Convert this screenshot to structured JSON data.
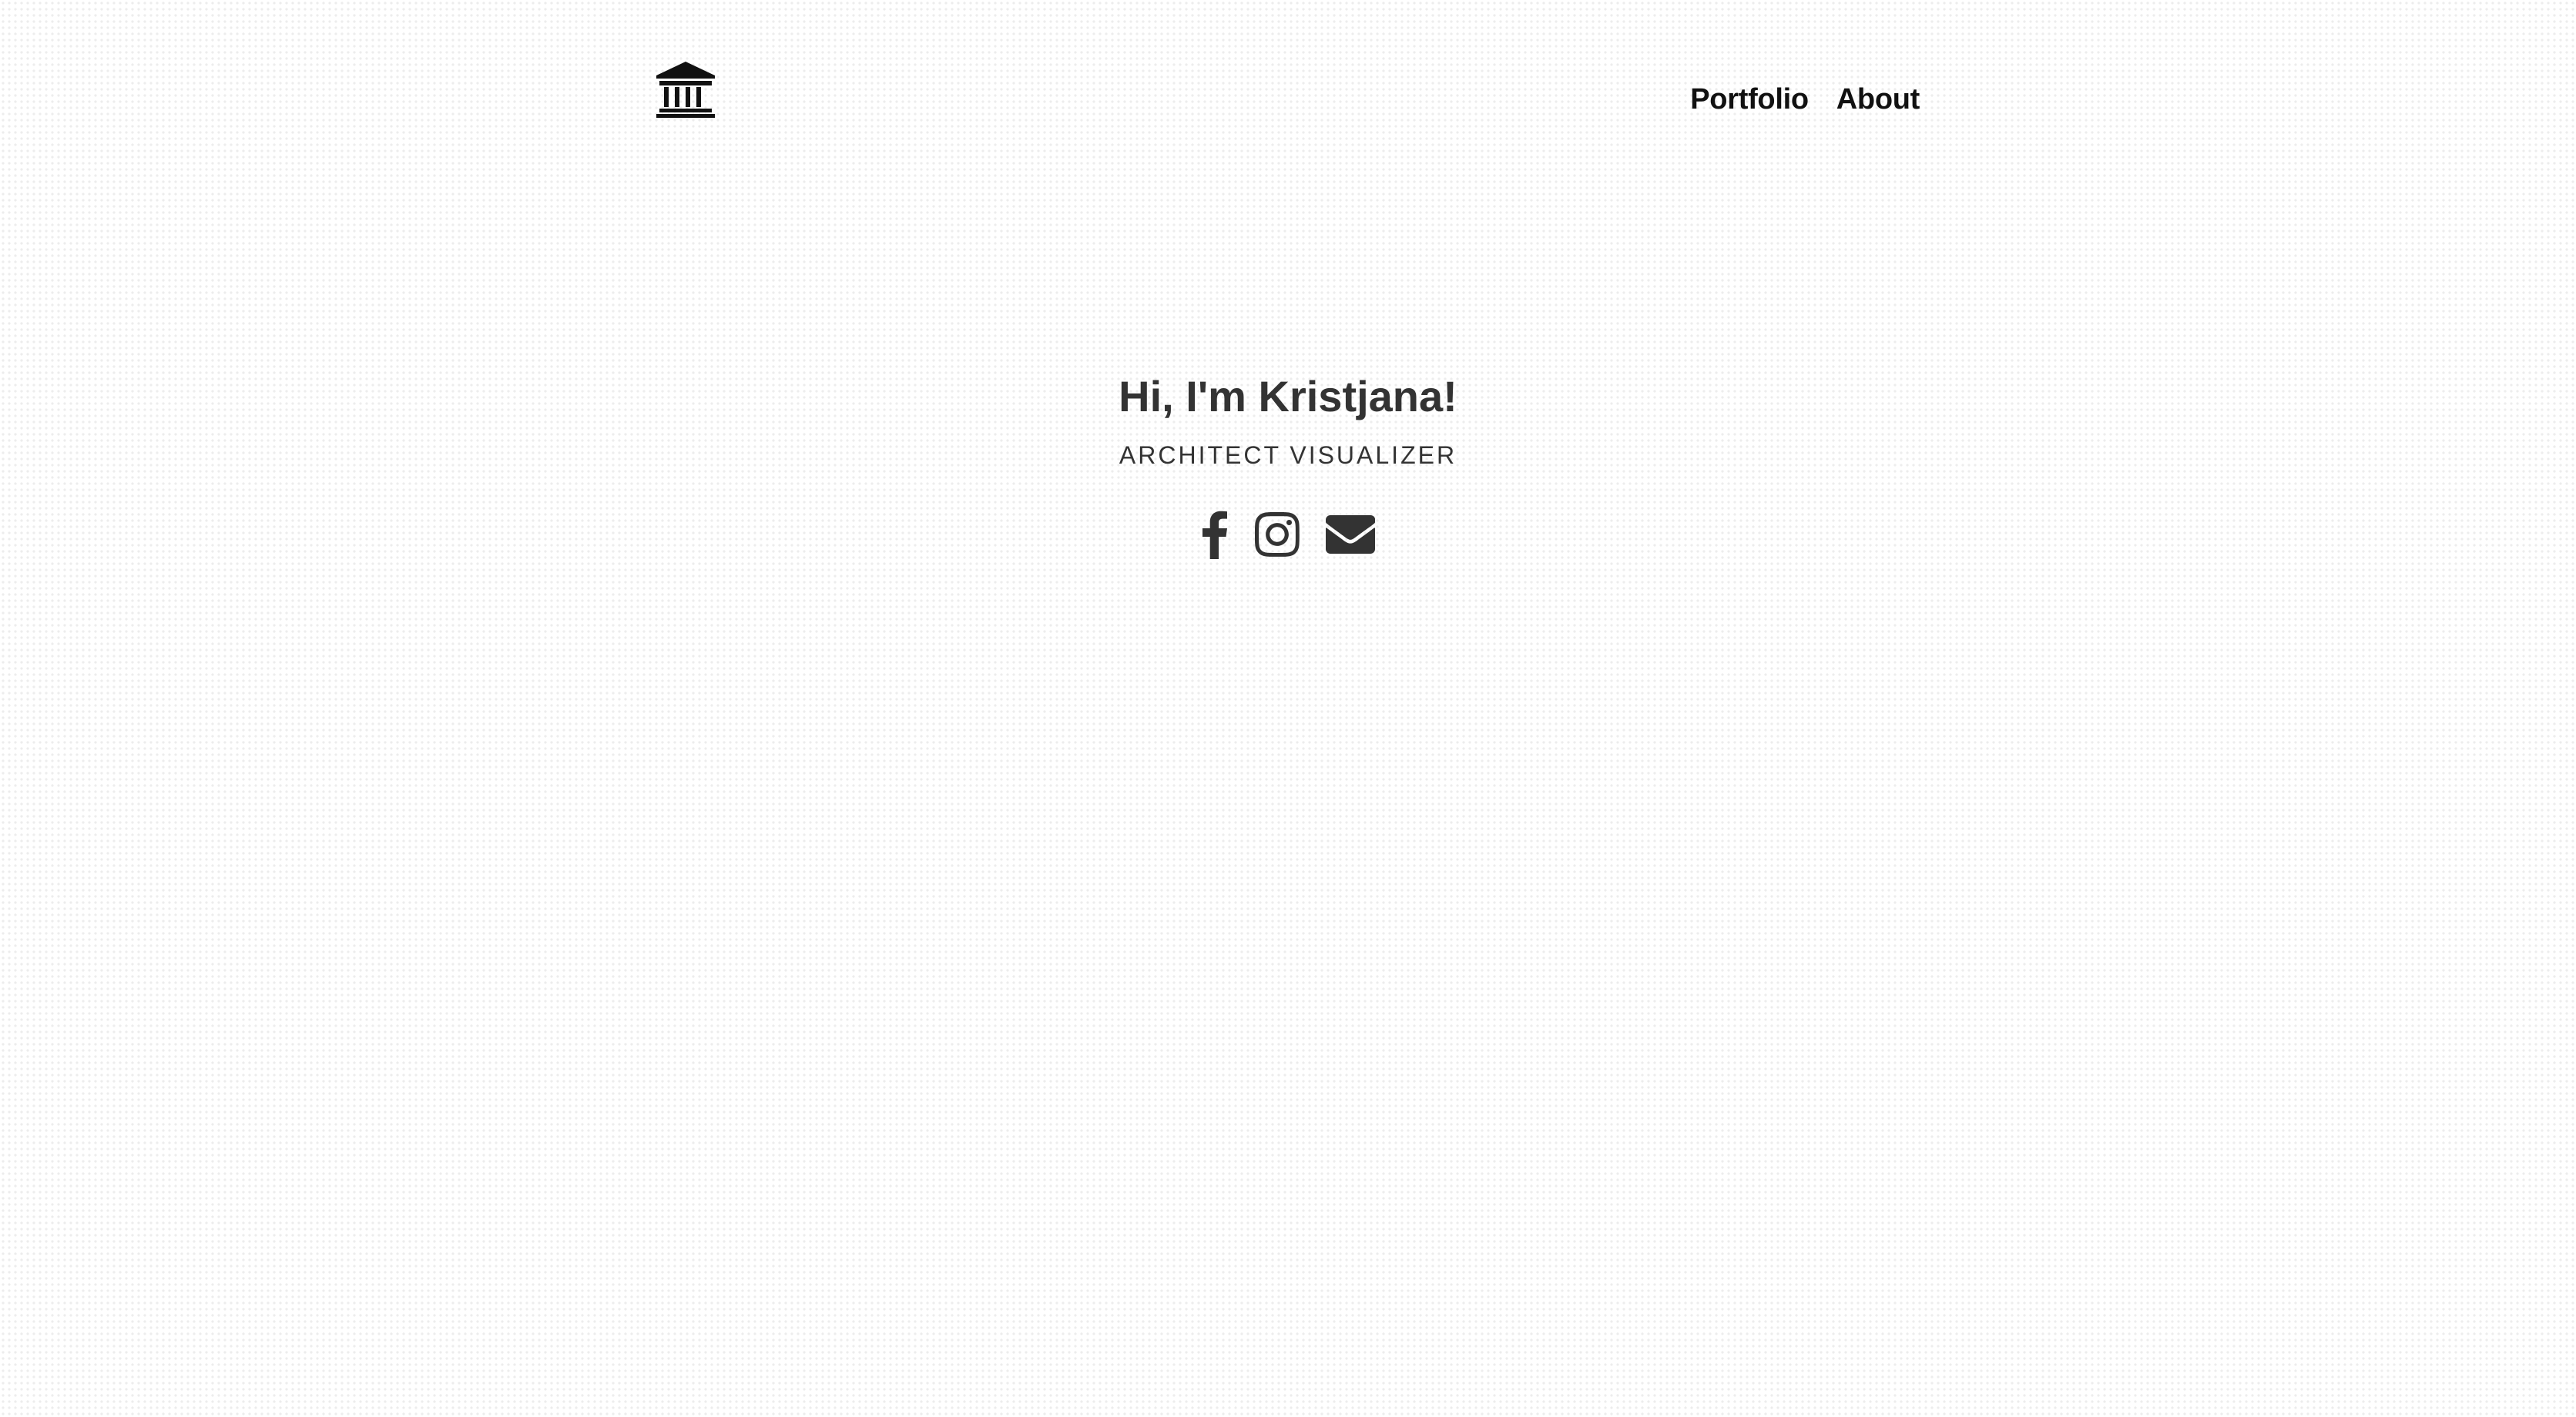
{
  "header": {
    "logo_icon": "bank-columns-icon",
    "nav": [
      {
        "label": "Portfolio"
      },
      {
        "label": "About"
      }
    ]
  },
  "hero": {
    "title": "Hi, I'm Kristjana!",
    "subtitle": "ARCHITECT VISUALIZER"
  },
  "social": {
    "icons": [
      "facebook-icon",
      "instagram-icon",
      "envelope-icon"
    ]
  },
  "colors": {
    "text": "#333333",
    "nav_text": "#111111",
    "background": "#ffffff"
  }
}
